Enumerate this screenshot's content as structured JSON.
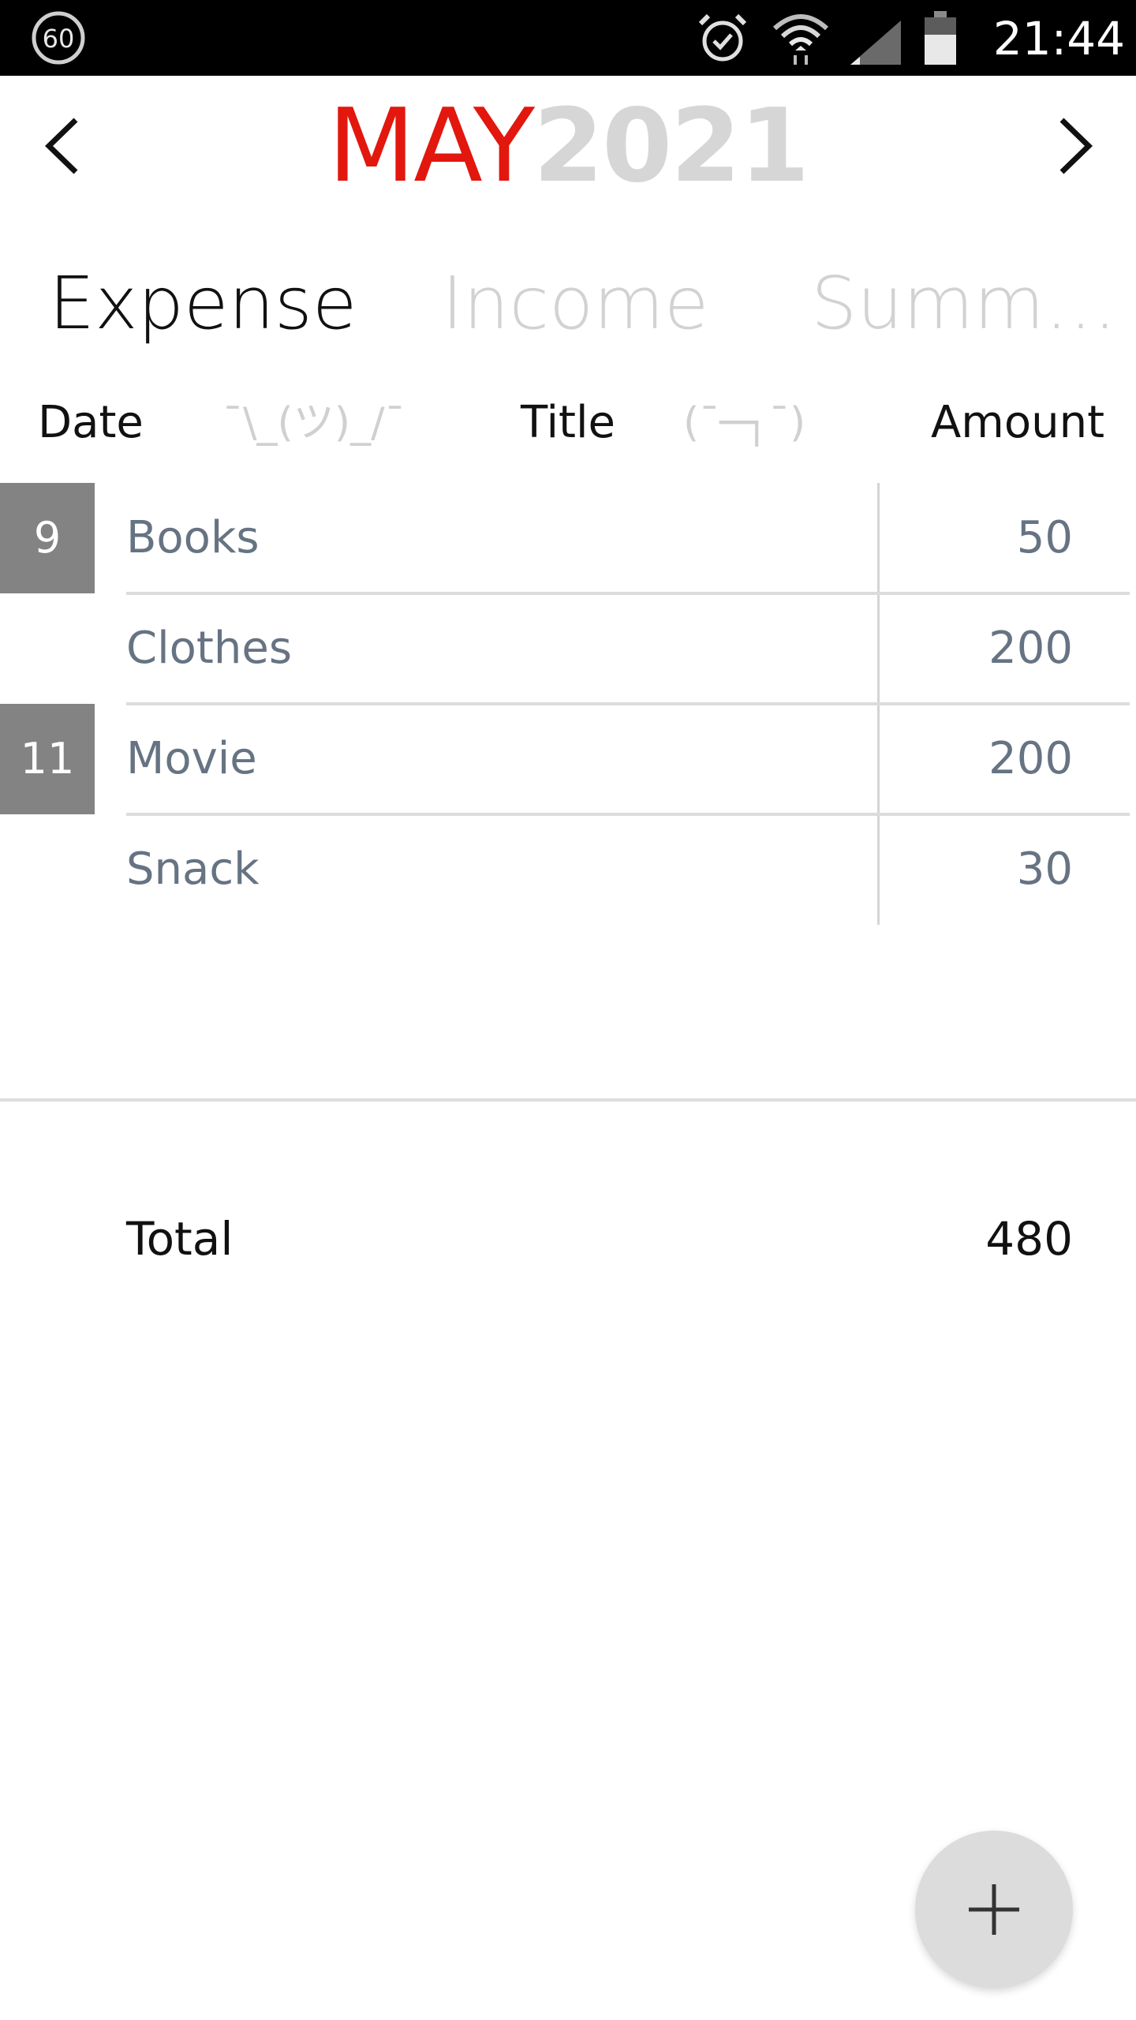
{
  "status_bar": {
    "badge_text": "60",
    "time": "21:44",
    "icons": [
      "fps-badge-icon",
      "alarm-icon",
      "wifi-icon",
      "cell-signal-icon",
      "battery-icon"
    ]
  },
  "header": {
    "month": "MAY",
    "year": "2021",
    "prev_icon": "chevron-left-icon",
    "next_icon": "chevron-right-icon",
    "accent_color": "#e2170e",
    "year_color": "#d6d6d6"
  },
  "tabs": [
    {
      "label": "Expense",
      "active": true
    },
    {
      "label": "Income",
      "active": false
    },
    {
      "label": "Summ…",
      "active": false
    }
  ],
  "columns": {
    "date": "Date",
    "deco1": "¯\\_(ツ)_/¯",
    "title": "Title",
    "deco2": "(¯─┐¯)",
    "amount": "Amount"
  },
  "entries": [
    {
      "date": "9",
      "title": "Books",
      "amount": "50"
    },
    {
      "date": "",
      "title": "Clothes",
      "amount": "200"
    },
    {
      "date": "11",
      "title": "Movie",
      "amount": "200"
    },
    {
      "date": "",
      "title": "Snack",
      "amount": "30"
    }
  ],
  "total": {
    "label": "Total",
    "value": "480"
  },
  "fab_icon": "plus-icon"
}
